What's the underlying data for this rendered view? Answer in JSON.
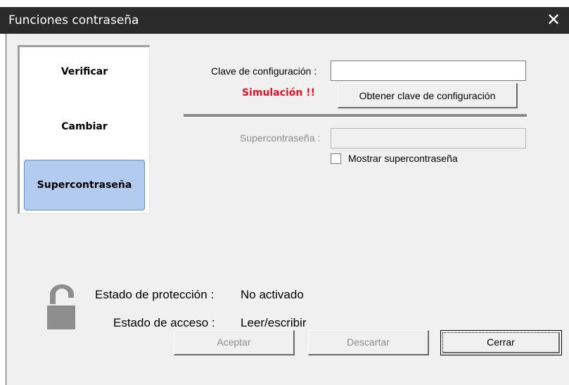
{
  "window": {
    "title": "Funciones contraseña",
    "close_glyph": "✕"
  },
  "tabs": [
    {
      "label": "Verificar"
    },
    {
      "label": "Cambiar"
    },
    {
      "label": "Supercontraseña",
      "selected": true
    }
  ],
  "form": {
    "config_key_label": "Clave de configuración :",
    "config_key_value": "",
    "simulation_text": "Simulación !!",
    "get_key_button": "Obtener clave de configuración",
    "supercontrasena_label": "Supercontraseña :",
    "supercontrasena_value": "",
    "show_super_label": "Mostrar supercontraseña",
    "show_super_checked": false
  },
  "status": {
    "icon": "padlock-open-icon",
    "protection_label": "Estado de protección :",
    "protection_value": "No activado",
    "access_label": "Estado de acceso :",
    "access_value": "Leer/escribir"
  },
  "buttons": {
    "accept": "Aceptar",
    "discard": "Descartar",
    "close": "Cerrar"
  },
  "colors": {
    "titlebar": "#2b2b2b",
    "selected_tab": "#b4cbf0",
    "simulation": "#e81123",
    "dialog_bg": "#f0f0f0"
  }
}
